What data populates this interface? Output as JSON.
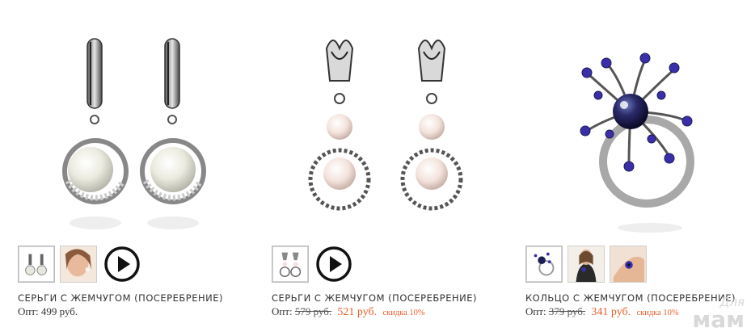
{
  "products": [
    {
      "title": "СЕРЬГИ С ЖЕМЧУГОМ (ПОСЕРЕБРЕНИЕ)",
      "price_label": "Опт:",
      "price": "499 руб.",
      "image_icon": "pearl-drop-earrings-icon"
    },
    {
      "title": "СЕРЬГИ С ЖЕМЧУГОМ (ПОСЕРЕБРЕНИЕ)",
      "price_label": "Опт:",
      "old_price": "579 руб.",
      "new_price": "521 руб.",
      "discount": "скидка 10%",
      "image_icon": "filigree-pearl-earrings-icon"
    },
    {
      "title": "КОЛЬЦО С ЖЕМЧУГОМ (ПОСЕРЕБРЕНИЕ)",
      "price_label": "Опт:",
      "old_price": "379 руб.",
      "new_price": "341 руб.",
      "discount": "скидка 10%",
      "image_icon": "peacock-pearl-ring-icon"
    }
  ],
  "watermark": {
    "line1": "Для",
    "line2": "мам"
  },
  "colors": {
    "sale": "#e8602b",
    "text": "#333333",
    "thumb_border": "#cfcfcf"
  }
}
